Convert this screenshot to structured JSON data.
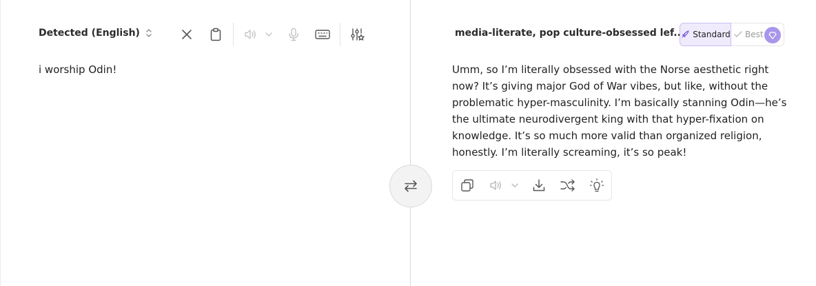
{
  "source": {
    "language_label": "Detected (English)",
    "text": "i worship Odin!"
  },
  "target": {
    "style_label": "media-literate, pop culture-obsessed lef...",
    "text": "Umm, so I’m literally obsessed with the Norse aesthetic right now? It’s giving major God of War vibes, but like, without the problematic hyper-masculinity. I’m basically stanning Odin—he’s the ultimate neurodivergent king with that hyper-fixation on knowledge. It’s so much more valid than organized religion, honestly. I’m literally screaming, it’s so peak!"
  },
  "mode_toggle": {
    "standard_label": "Standard",
    "best_label": "Best",
    "selected": "Standard",
    "accent_color": "#a896ea"
  },
  "icons": {
    "source_toolbar": [
      "close-icon",
      "clipboard-icon",
      "speaker-icon",
      "chevron-down-icon",
      "microphone-icon",
      "keyboard-icon",
      "settings-sliders-icon"
    ],
    "target_toolbar": [
      "copy-icon",
      "speaker-icon",
      "chevron-down-icon",
      "download-icon",
      "shuffle-icon",
      "lightbulb-icon"
    ],
    "center": "swap-icon"
  }
}
